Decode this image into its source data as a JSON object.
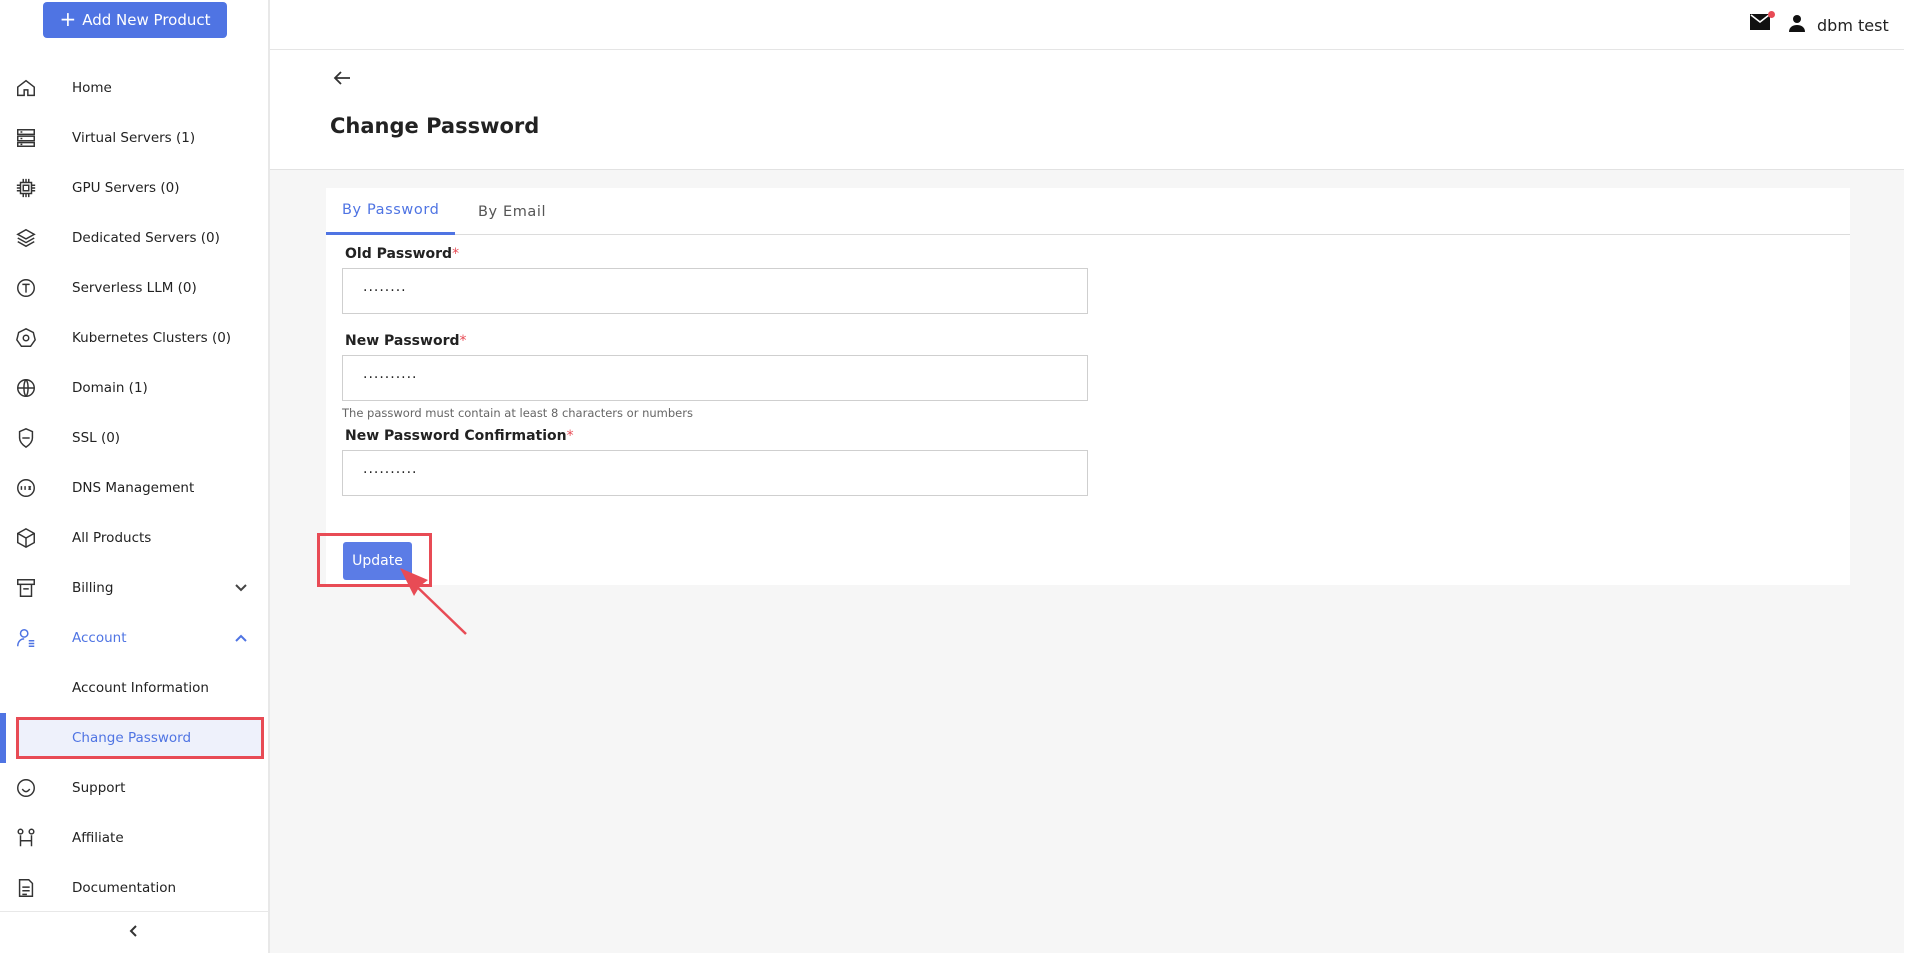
{
  "sidebar": {
    "add_button": "Add New Product",
    "items": [
      {
        "label": "Home"
      },
      {
        "label": "Virtual Servers (1)"
      },
      {
        "label": "GPU Servers (0)"
      },
      {
        "label": "Dedicated Servers (0)"
      },
      {
        "label": "Serverless LLM (0)"
      },
      {
        "label": "Kubernetes Clusters (0)"
      },
      {
        "label": "Domain (1)"
      },
      {
        "label": "SSL (0)"
      },
      {
        "label": "DNS Management"
      },
      {
        "label": "All Products"
      },
      {
        "label": "Billing"
      },
      {
        "label": "Account"
      },
      {
        "label": "Account Information"
      },
      {
        "label": "Change Password"
      },
      {
        "label": "Support"
      },
      {
        "label": "Affiliate"
      },
      {
        "label": "Documentation"
      }
    ]
  },
  "topbar": {
    "user_name": "dbm test"
  },
  "page": {
    "title": "Change Password"
  },
  "tabs": [
    {
      "label": "By Password"
    },
    {
      "label": "By Email"
    }
  ],
  "form": {
    "old_password": {
      "label": "Old Password",
      "value": "········"
    },
    "new_password": {
      "label": "New Password",
      "value": "··········",
      "hint": "The password must contain at least 8 characters or numbers"
    },
    "confirm_password": {
      "label": "New Password Confirmation",
      "value": "··········"
    },
    "required_mark": "*",
    "update_label": "Update"
  },
  "colors": {
    "accent": "#4f74e3",
    "highlight": "#e84b55"
  }
}
